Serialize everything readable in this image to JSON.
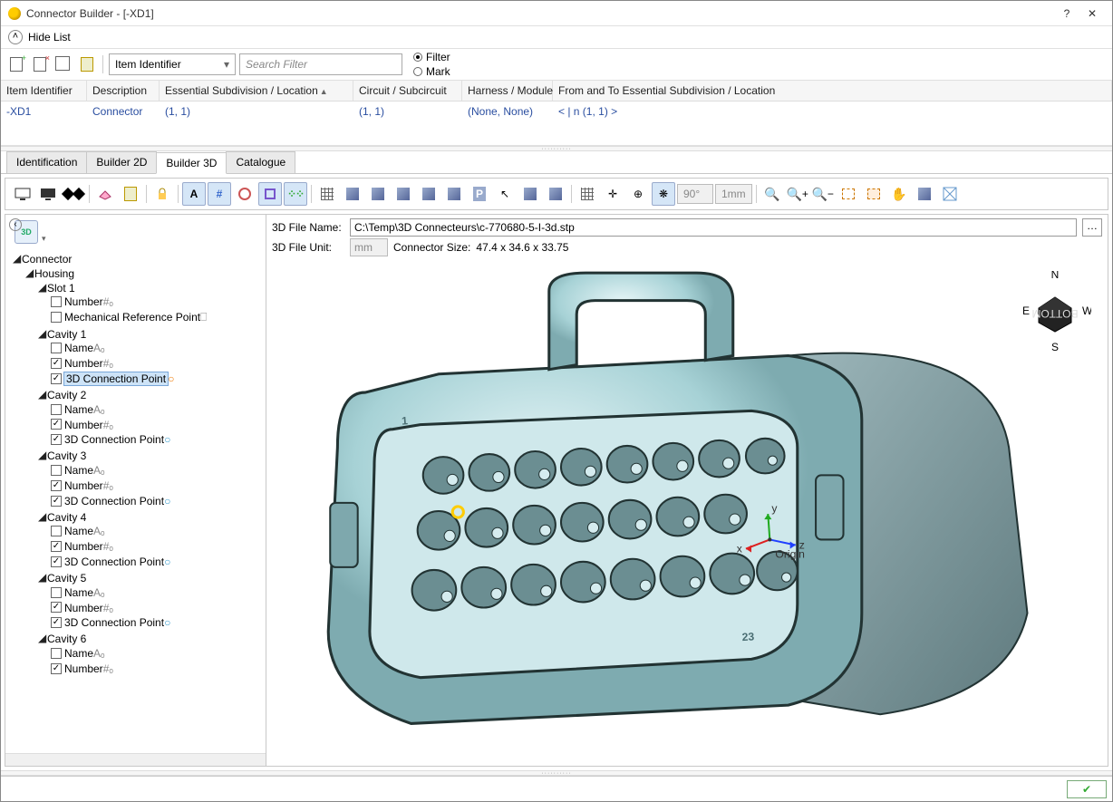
{
  "window": {
    "title": "Connector Builder - [-XD1]",
    "help": "?",
    "close": "✕"
  },
  "hideList": {
    "label": "Hide List"
  },
  "toolbar1": {
    "dropdown": "Item Identifier",
    "searchPlaceholder": "Search Filter",
    "filterLabel": "Filter",
    "markLabel": "Mark"
  },
  "grid": {
    "headers": {
      "col1": "Item Identifier",
      "col2": "Description",
      "col3": "Essential Subdivision / Location",
      "col4": "Circuit / Subcircuit",
      "col5": "Harness / Module",
      "col6": "From and To Essential Subdivision / Location"
    },
    "row": {
      "id": "-XD1",
      "desc": "Connector",
      "loc": "(1, 1)",
      "circuit": "(1, 1)",
      "harness": "(None, None)",
      "fromto": "<  | n (1, 1)  >"
    }
  },
  "tabs": {
    "t1": "Identification",
    "t2": "Builder 2D",
    "t3": "Builder 3D",
    "t4": "Catalogue"
  },
  "toolbar3d": {
    "angle": "90°",
    "dist": "1mm"
  },
  "tree": {
    "root": "Connector",
    "housing": "Housing",
    "slot1": "Slot 1",
    "number": "Number",
    "mechref": "Mechanical Reference Point",
    "name": "Name",
    "conn3d": "3D Connection Point",
    "cav1": "Cavity 1",
    "cav2": "Cavity 2",
    "cav3": "Cavity 3",
    "cav4": "Cavity 4",
    "cav5": "Cavity 5",
    "cav6": "Cavity 6"
  },
  "viewport": {
    "fileNameLabel": "3D File Name:",
    "fileName": "C:\\Temp\\3D Connecteurs\\c-770680-5-I-3d.stp",
    "unitLabel": "3D File Unit:",
    "unit": "mm",
    "sizeLabel": "Connector Size:",
    "size": "47.4 x 34.6 x 33.75",
    "origin": "Origin",
    "pin1": "1",
    "pin23": "23",
    "nav": {
      "n": "N",
      "s": "S",
      "e": "E",
      "w": "W",
      "face": "BOTTOM"
    }
  }
}
